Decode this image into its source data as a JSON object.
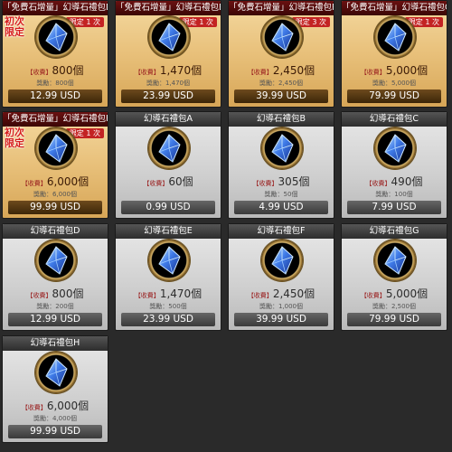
{
  "cards": [
    {
      "title": "「免費石增量」幻導石禮包D",
      "limited": "限定 1 次",
      "first": "初次限定",
      "amount": "800個",
      "bonus": "獎勵：800個",
      "usd": "12.99 USD",
      "style": "gold"
    },
    {
      "title": "「免費石增量」幻導石禮包E",
      "limited": "限定 1 次",
      "first": "",
      "amount": "1,470個",
      "bonus": "獎勵：1,470個",
      "usd": "23.99 USD",
      "style": "gold"
    },
    {
      "title": "「免費石增量」幻導石禮包F",
      "limited": "限定 3 次",
      "first": "",
      "amount": "2,450個",
      "bonus": "獎勵：2,450個",
      "usd": "39.99 USD",
      "style": "gold"
    },
    {
      "title": "「免費石增量」幻導石禮包G",
      "limited": "限定 1 次",
      "first": "",
      "amount": "5,000個",
      "bonus": "獎勵：5,000個",
      "usd": "79.99 USD",
      "style": "gold"
    },
    {
      "title": "「免費石增量」幻導石禮包H",
      "limited": "限定 1 次",
      "first": "初次限定",
      "amount": "6,000個",
      "bonus": "獎勵：6,000個",
      "usd": "99.99 USD",
      "style": "gold"
    },
    {
      "title": "幻導石禮包A",
      "limited": "",
      "first": "",
      "amount": "60個",
      "bonus": "",
      "usd": "0.99 USD",
      "style": "silver"
    },
    {
      "title": "幻導石禮包B",
      "limited": "",
      "first": "",
      "amount": "305個",
      "bonus": "獎勵：50個",
      "usd": "4.99 USD",
      "style": "silver"
    },
    {
      "title": "幻導石禮包C",
      "limited": "",
      "first": "",
      "amount": "490個",
      "bonus": "獎勵：100個",
      "usd": "7.99 USD",
      "style": "silver"
    },
    {
      "title": "幻導石禮包D",
      "limited": "",
      "first": "",
      "amount": "800個",
      "bonus": "獎勵：200個",
      "usd": "12.99 USD",
      "style": "silver"
    },
    {
      "title": "幻導石禮包E",
      "limited": "",
      "first": "",
      "amount": "1,470個",
      "bonus": "獎勵：500個",
      "usd": "23.99 USD",
      "style": "silver"
    },
    {
      "title": "幻導石禮包F",
      "limited": "",
      "first": "",
      "amount": "2,450個",
      "bonus": "獎勵：1,000個",
      "usd": "39.99 USD",
      "style": "silver"
    },
    {
      "title": "幻導石禮包G",
      "limited": "",
      "first": "",
      "amount": "5,000個",
      "bonus": "獎勵：2,500個",
      "usd": "79.99 USD",
      "style": "silver"
    },
    {
      "title": "幻導石禮包H",
      "limited": "",
      "first": "",
      "amount": "6,000個",
      "bonus": "獎勵：4,000個",
      "usd": "99.99 USD",
      "style": "silver"
    }
  ],
  "labels": {
    "paid_tag": "【收費】"
  },
  "colors": {
    "gold_bg": "#e8c07a",
    "silver_bg": "#cfcfcf",
    "limited_red": "#c32323",
    "first_red": "#d61e1e",
    "gem_blue": "#2e5fd6"
  },
  "icons": {
    "gem": "blue-crystal-icon"
  }
}
